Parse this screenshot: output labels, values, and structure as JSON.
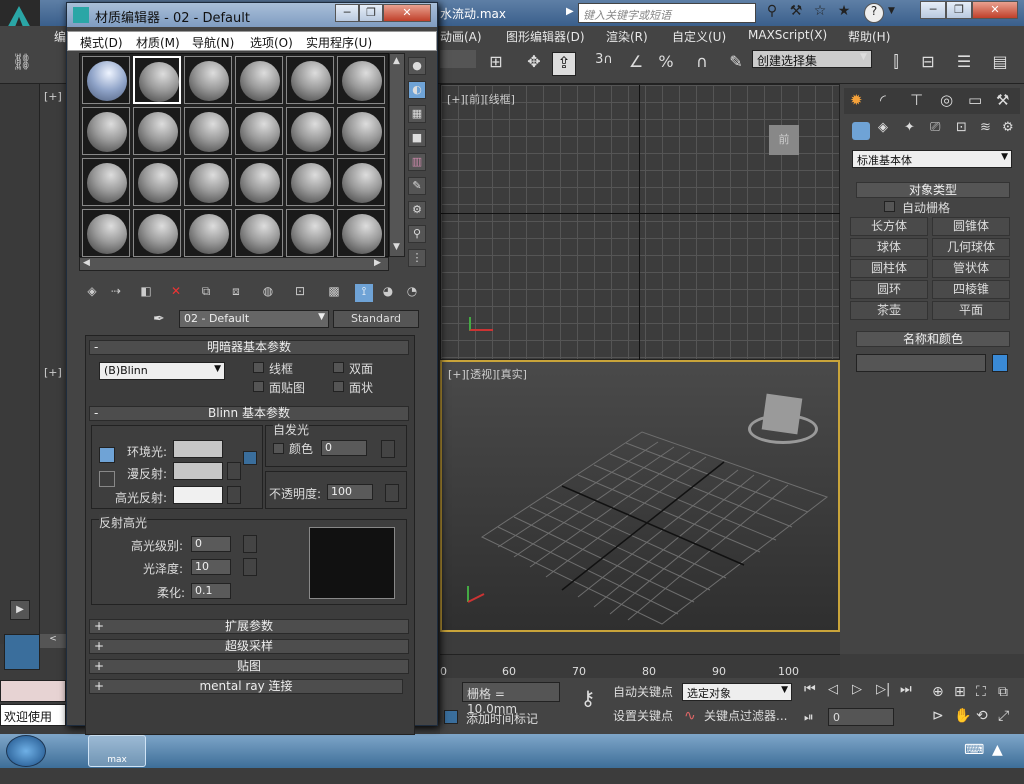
{
  "titlebar": {
    "filename": "水流动.max",
    "search_placeholder": "键入关键字或短语",
    "icons": [
      "binoculars-icon",
      "wrench-icon",
      "star-outline-icon",
      "star-icon",
      "help-icon"
    ],
    "help_arrow": "▼"
  },
  "menubar": {
    "left_fragment": "编",
    "items": [
      "动画(A)",
      "图形编辑器(D)",
      "渲染(R)",
      "自定义(U)",
      "MAXScript(X)",
      "帮助(H)"
    ]
  },
  "toolbar": {
    "selection_set": "创建选择集",
    "snap_label": "3"
  },
  "viewports": {
    "top_label": "[+]",
    "front_label": "[+][前][线框]",
    "left_label": "[+]",
    "persp_label": "[+][透视][真实]",
    "front_cube_text": "前"
  },
  "command_panel": {
    "category_dropdown": "标准基本体",
    "object_type_header": "对象类型",
    "autogrid_label": "自动栅格",
    "buttons": [
      "长方体",
      "圆锥体",
      "球体",
      "几何球体",
      "圆柱体",
      "管状体",
      "圆环",
      "四棱锥",
      "茶壶",
      "平面"
    ],
    "name_color_header": "名称和颜色",
    "name_value": "",
    "color": "#3a8ad6"
  },
  "timeline": {
    "ticks": [
      "0",
      "60",
      "70",
      "80",
      "90",
      "100"
    ]
  },
  "status": {
    "grid_label": "栅格 = 10.0mm",
    "auto_key": "自动关键点",
    "selected_object": "选定对象",
    "set_key": "设置关键点",
    "key_filter": "关键点过滤器...",
    "add_time_tag": "添加时间标记",
    "frame_value": "0",
    "welcome": "欢迎使用"
  },
  "material_editor": {
    "title": "材质编辑器 - 02 - Default",
    "menu": [
      "模式(D)",
      "材质(M)",
      "导航(N)",
      "选项(O)",
      "实用程序(U)"
    ],
    "material_name": "02 - Default",
    "material_type": "Standard",
    "shader_section": "明暗器基本参数",
    "shader_value": "(B)Blinn",
    "wire_label": "线框",
    "two_sided_label": "双面",
    "face_map_label": "面贴图",
    "faceted_label": "面状",
    "blinn_section": "Blinn 基本参数",
    "self_illum_group": "自发光",
    "self_illum_color_label": "颜色",
    "self_illum_value": "0",
    "ambient_label": "环境光:",
    "diffuse_label": "漫反射:",
    "specular_label": "高光反射:",
    "opacity_label": "不透明度:",
    "opacity_value": "100",
    "spec_highlights_group": "反射高光",
    "spec_level_label": "高光级别:",
    "spec_level_value": "0",
    "glossiness_label": "光泽度:",
    "glossiness_value": "10",
    "soften_label": "柔化:",
    "soften_value": "0.1",
    "rollouts": [
      "扩展参数",
      "超级采样",
      "贴图",
      "mental ray 连接"
    ]
  },
  "taskbar": {
    "app_label": "max"
  }
}
